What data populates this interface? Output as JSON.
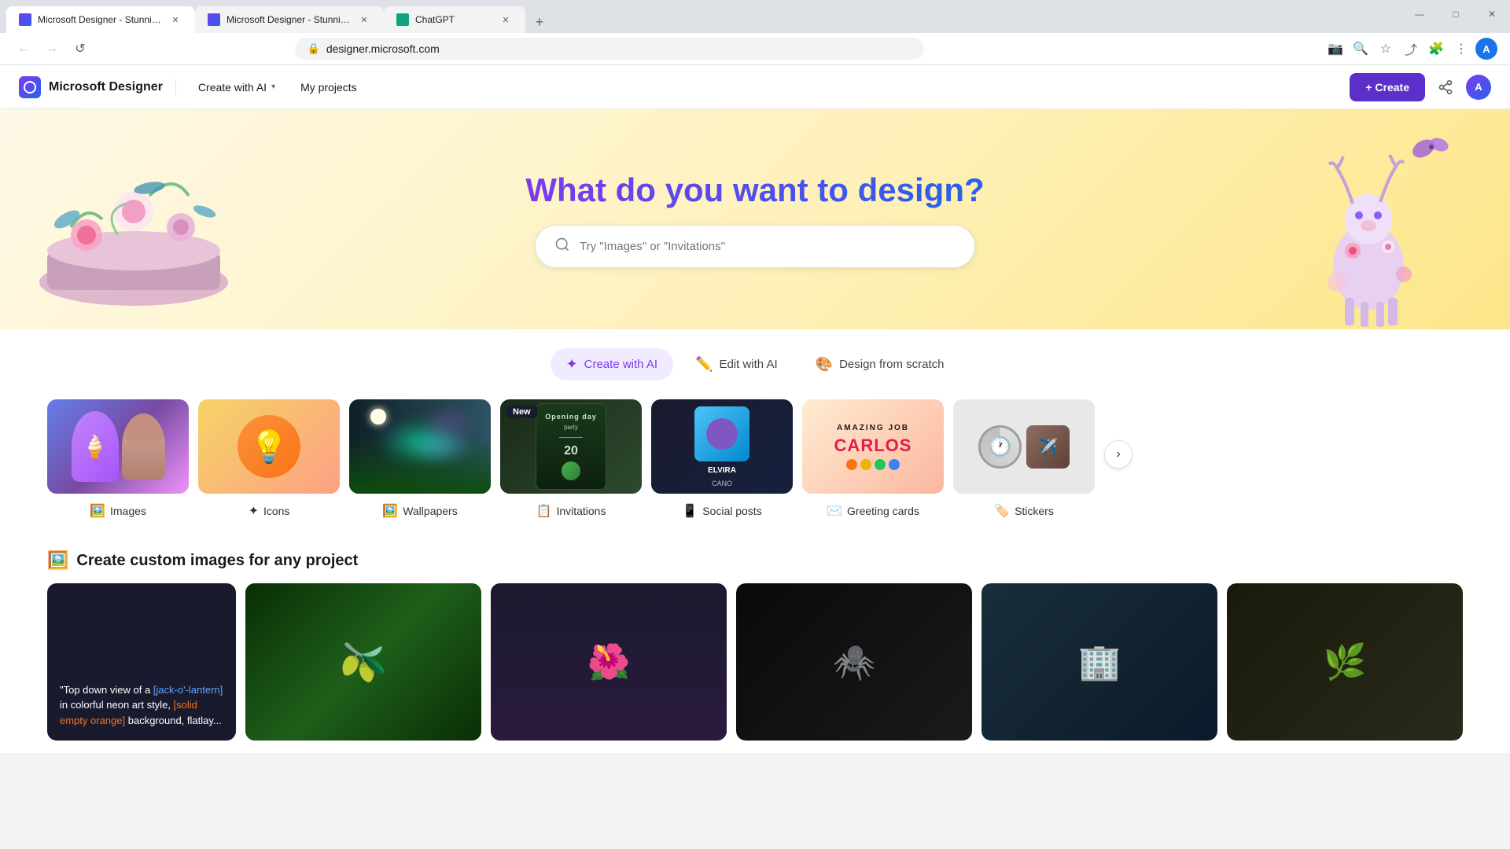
{
  "browser": {
    "tabs": [
      {
        "id": "tab1",
        "title": "Microsoft Designer - Stunning ...",
        "active": true,
        "favicon_color": "#7c3aed"
      },
      {
        "id": "tab2",
        "title": "Microsoft Designer - Stunning ...",
        "active": false,
        "favicon_color": "#7c3aed"
      },
      {
        "id": "tab3",
        "title": "ChatGPT",
        "active": false,
        "favicon_color": "#10a37f"
      }
    ],
    "add_tab_label": "+",
    "url": "designer.microsoft.com",
    "back_btn": "←",
    "forward_btn": "→",
    "refresh_btn": "↺",
    "window_minimize": "—",
    "window_maximize": "□",
    "window_close": "✕"
  },
  "nav": {
    "brand_name": "Microsoft Designer",
    "menu_items": [
      {
        "id": "create-with-ai",
        "label": "Create with AI",
        "has_dropdown": true
      },
      {
        "id": "my-projects",
        "label": "My projects",
        "has_dropdown": false
      }
    ],
    "create_button": "+ Create"
  },
  "hero": {
    "title": "What do you want to design?",
    "search_placeholder": "Try \"Images\" or \"Invitations\""
  },
  "section_tabs": [
    {
      "id": "create-with-ai",
      "label": "Create with AI",
      "icon": "✦",
      "active": true
    },
    {
      "id": "edit-with-ai",
      "label": "Edit with AI",
      "icon": "✏️",
      "active": false
    },
    {
      "id": "design-from-scratch",
      "label": "Design from scratch",
      "icon": "🎨",
      "active": false
    }
  ],
  "categories": [
    {
      "id": "images",
      "label": "Images",
      "icon": "🖼️",
      "has_new": false
    },
    {
      "id": "icons",
      "label": "Icons",
      "icon": "✦",
      "has_new": false
    },
    {
      "id": "wallpapers",
      "label": "Wallpapers",
      "icon": "🖼️",
      "has_new": false
    },
    {
      "id": "invitations",
      "label": "Invitations",
      "icon": "📋",
      "has_new": true
    },
    {
      "id": "social-posts",
      "label": "Social posts",
      "icon": "📱",
      "has_new": false
    },
    {
      "id": "greeting-cards",
      "label": "Greeting cards",
      "icon": "✉️",
      "has_new": false
    },
    {
      "id": "stickers",
      "label": "Stickers",
      "icon": "🏷️",
      "has_new": false
    }
  ],
  "custom_section": {
    "title": "Create custom images for any project",
    "icon": "🖼️",
    "first_card_text": "\"Top down view of a [jack-o'-lantern] in colorful neon art style, [solid empty orange] background, flatlay.",
    "highlight_words": [
      "jack-o'-lantern",
      "solid empty orange"
    ]
  },
  "colors": {
    "primary_purple": "#7c3aed",
    "primary_blue": "#2563eb",
    "hero_bg": "#fef9e7",
    "tab_active_bg": "#f0ebff",
    "create_btn_bg": "#5b2fc9"
  }
}
